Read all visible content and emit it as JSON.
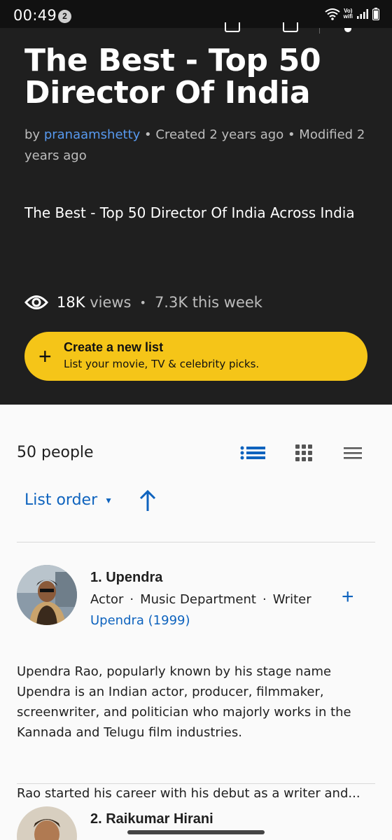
{
  "status_bar": {
    "time": "00:49",
    "notification_count": "2",
    "network_label_top": "Vo)",
    "network_label_bottom": "wifi"
  },
  "list": {
    "title": "The Best - Top 50 Director Of India",
    "meta_by": "by",
    "author": "pranaamshetty",
    "meta_rest": "• Created 2 years ago • Modified 2 years ago",
    "description": "The Best - Top 50 Director Of India Across India",
    "views_count": "18K",
    "views_label": "views",
    "separator": "•",
    "this_week": "7.3K this week"
  },
  "create_list": {
    "title": "Create a new list",
    "subtitle": "List your movie, TV & celebrity picks."
  },
  "toolbar": {
    "people_count": "50 people",
    "sort_label": "List order",
    "selected_view": "detailed-list"
  },
  "items": [
    {
      "title": "1. Upendra",
      "roles": [
        "Actor",
        "Music Department",
        "Writer"
      ],
      "known_for": "Upendra (1999)",
      "description_p1": "Upendra Rao, popularly known by his stage name Upendra is an Indian actor, producer, filmmaker, screenwriter, and politician who majorly works in the Kannada and Telugu film industries.",
      "description_p2": "Rao started his career with his debut as a writer and..."
    },
    {
      "title": "2. Raikumar Hirani"
    }
  ],
  "colors": {
    "dark_bg": "#1f1f1f",
    "accent_yellow": "#f5c518",
    "link_blue": "#0e63be",
    "author_blue": "#5799ef"
  }
}
